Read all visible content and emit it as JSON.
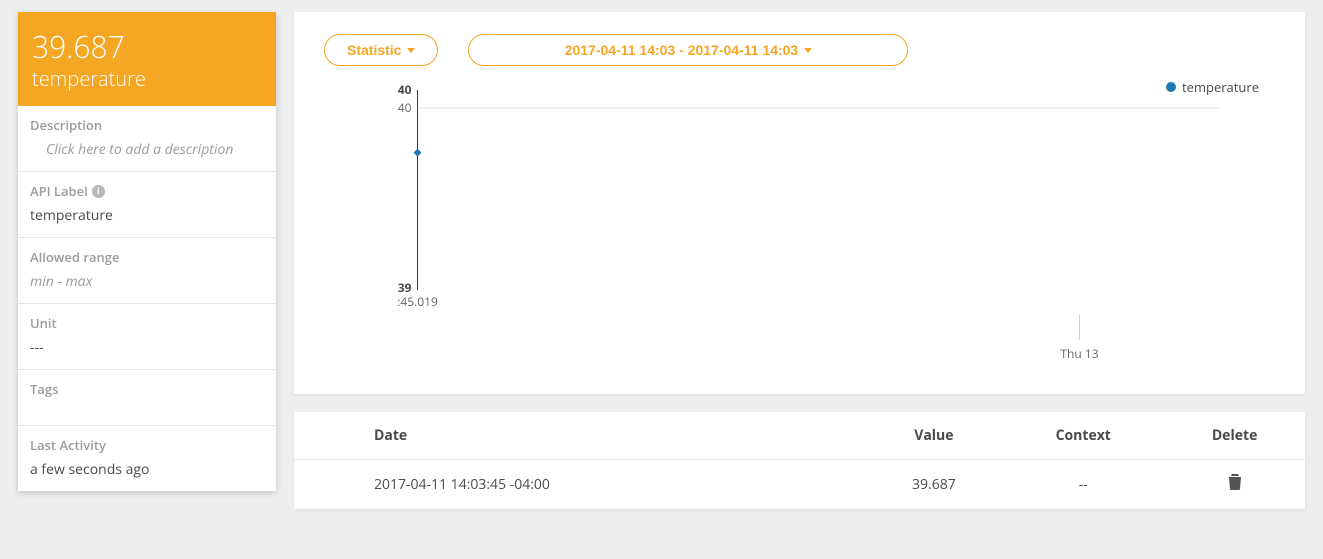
{
  "sidebar": {
    "value": "39.687",
    "name": "temperature",
    "description_label": "Description",
    "description_placeholder": "Click here to add a description",
    "api_label_label": "API Label",
    "api_label_value": "temperature",
    "allowed_range_label": "Allowed range",
    "allowed_range_value": "min - max",
    "unit_label": "Unit",
    "unit_value": "---",
    "tags_label": "Tags",
    "tags_value": "",
    "last_activity_label": "Last Activity",
    "last_activity_value": "a few seconds ago"
  },
  "toolbar": {
    "statistic_label": "Statistic",
    "daterange_label": "2017-04-11 14:03 - 2017-04-11 14:03"
  },
  "legend": {
    "series_name": "temperature"
  },
  "chart_data": {
    "type": "line",
    "series": [
      {
        "name": "temperature",
        "values": [
          39.687
        ]
      }
    ],
    "x": [
      ":45.019"
    ],
    "ylim": [
      39,
      40
    ],
    "y_ticks": [
      "40",
      "40",
      "39"
    ],
    "x_tick_extra": "Thu 13",
    "xlabel": "",
    "ylabel": "",
    "title": ""
  },
  "table": {
    "headers": {
      "date": "Date",
      "value": "Value",
      "context": "Context",
      "delete": "Delete"
    },
    "rows": [
      {
        "date": "2017-04-11 14:03:45 -04:00",
        "value": "39.687",
        "context": "--"
      }
    ]
  }
}
